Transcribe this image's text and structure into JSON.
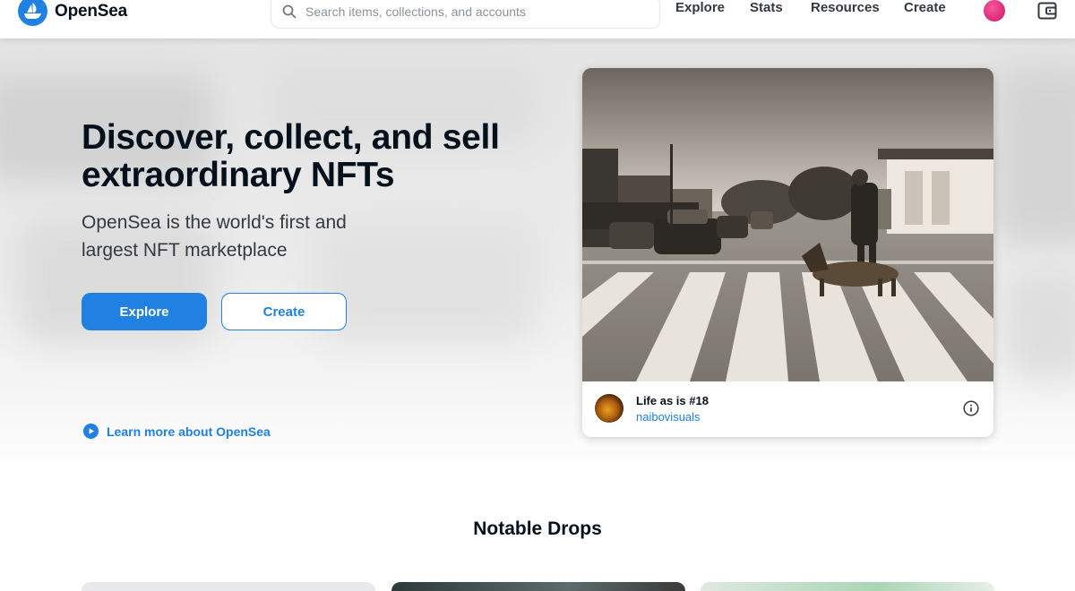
{
  "brand": {
    "name": "OpenSea",
    "accent": "#2081e2"
  },
  "search": {
    "placeholder": "Search items, collections, and accounts"
  },
  "nav": {
    "explore": "Explore",
    "stats": "Stats",
    "resources": "Resources",
    "create": "Create"
  },
  "hero": {
    "title": "Discover, collect, and sell extraordinary NFTs",
    "subtitle": "OpenSea is the world's first and largest NFT marketplace",
    "primary_button": "Explore",
    "secondary_button": "Create",
    "learn_more": "Learn more about OpenSea"
  },
  "featured": {
    "title": "Life as is #18",
    "creator": "naibovisuals"
  },
  "notable": {
    "title": "Notable Drops"
  },
  "icons": {
    "logo": "opensea-logo-icon",
    "search": "search-icon",
    "profile": "avatar",
    "wallet": "wallet-icon",
    "learn": "play-circle-icon",
    "info": "info-icon"
  }
}
